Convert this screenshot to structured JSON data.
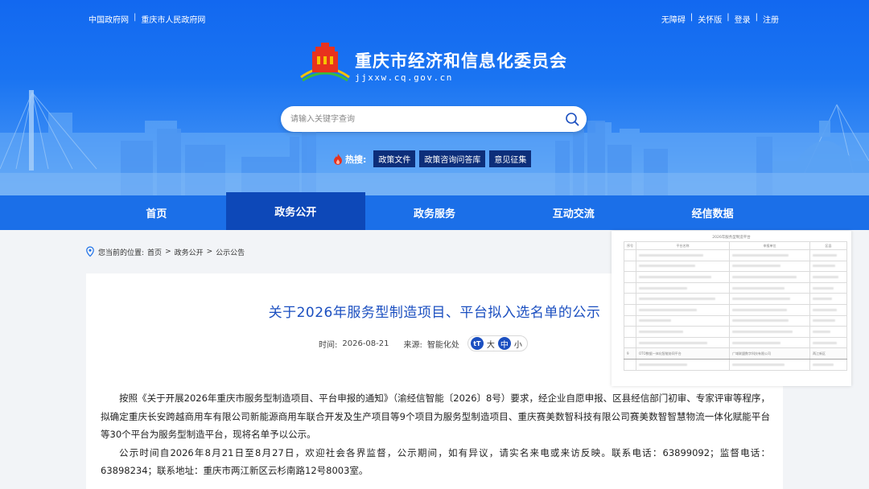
{
  "header": {
    "top_links": [
      "中国政府网",
      "重庆市人民政府网"
    ],
    "right_links": [
      "无障碍",
      "关怀版",
      "登录",
      "注册"
    ],
    "site_title": "重庆市经济和信息化委员会",
    "site_domain": "jjxxw.cq.gov.cn"
  },
  "search": {
    "placeholder": "请输入关键字查询"
  },
  "hot": {
    "label": "热搜:",
    "tags": [
      "政策文件",
      "政策咨询问答库",
      "意见征集"
    ]
  },
  "nav": {
    "items": [
      "首页",
      "政务公开",
      "政务服务",
      "互动交流",
      "经信数据"
    ],
    "active_index": 1
  },
  "breadcrumb": {
    "prefix": "您当前的位置:",
    "path": [
      "首页",
      "政务公开",
      "公示公告"
    ]
  },
  "article": {
    "title": "关于2026年服务型制造项目、平台拟入选名单的公示",
    "time_label": "时间:",
    "time": "2026-08-21",
    "source_label": "来源:",
    "source": "智能化处",
    "font_sizes": [
      "大",
      "中",
      "小"
    ],
    "paragraphs": [
      "按照《关于开展2026年重庆市服务型制造项目、平台申报的通知》（渝经信智能〔2026〕8号）要求，经企业自愿申报、区县经信部门初审、专家评审等程序，拟确定重庆长安跨越商用车有限公司新能源商用车联合开发及生产项目等9个项目为服务型制造项目、重庆赛美数智科技有限公司赛美数智智慧物流一体化赋能平台等30个平台为服务型制造平台，现将名单予以公示。",
      "公示时间自2026年8月21日至8月27日，欢迎社会各界监督，公示期间，如有异议，请实名来电或来访反映。联系电话：63899092；监督电话：63898234；联系地址：重庆市两江新区云杉南路12号8003室。"
    ]
  },
  "doc_preview": {
    "title": "2026年服务型制造平台",
    "headers": [
      "序号",
      "平台名称",
      "申报单位",
      "区县"
    ],
    "highlight_row": {
      "no": "9",
      "name": "OTO数据一体化智能协同平台",
      "unit": "广域联盟数字科技有限公司",
      "district": "两江新区"
    }
  },
  "colors": {
    "header_blue": "#1a74f2",
    "nav_blue": "#1b6fe8",
    "nav_active": "#0d48b8",
    "title_blue": "#1b4fc0",
    "hot_tag_bg": "#0d2e7a"
  }
}
